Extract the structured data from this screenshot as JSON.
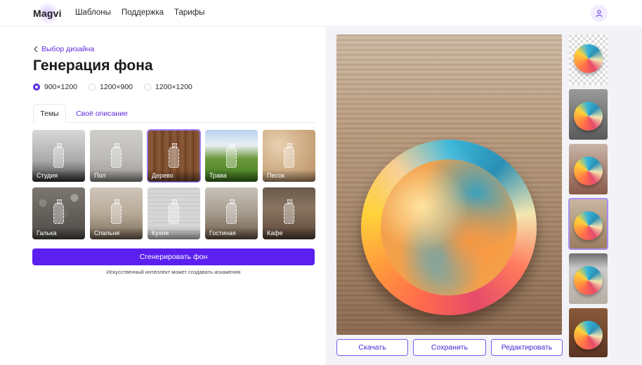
{
  "header": {
    "logo": "Magvi",
    "nav": [
      "Шаблоны",
      "Поддержка",
      "Тарифы"
    ],
    "profile_icon": "user-icon"
  },
  "left": {
    "back_link": "Выбор дизайна",
    "title": "Генерация фона",
    "sizes": [
      {
        "label": "900×1200",
        "selected": true
      },
      {
        "label": "1200×900",
        "selected": false
      },
      {
        "label": "1200×1200",
        "selected": false
      }
    ],
    "tabs": [
      {
        "label": "Темы",
        "active": true
      },
      {
        "label": "Своё описание",
        "active": false
      }
    ],
    "themes": [
      {
        "label": "Студия",
        "selected": false
      },
      {
        "label": "Пол",
        "selected": false
      },
      {
        "label": "Дерево",
        "selected": true
      },
      {
        "label": "Трава",
        "selected": false
      },
      {
        "label": "Песок",
        "selected": false
      },
      {
        "label": "Галька",
        "selected": false
      },
      {
        "label": "Спальня",
        "selected": false
      },
      {
        "label": "Кухня",
        "selected": false
      },
      {
        "label": "Гостиная",
        "selected": false
      },
      {
        "label": "Кафе",
        "selected": false
      }
    ],
    "generate_button": "Сгенерировать фон",
    "disclaimer": "Искусственный интеллект может создавать искажения"
  },
  "right": {
    "actions": [
      "Скачать",
      "Сохранить",
      "Редактировать"
    ],
    "thumbnails": [
      {
        "background": "transparent",
        "selected": false
      },
      {
        "background": "studio",
        "selected": false
      },
      {
        "background": "wall",
        "selected": false
      },
      {
        "background": "wood",
        "selected": true
      },
      {
        "background": "interior",
        "selected": false
      },
      {
        "background": "wood-dark",
        "selected": false
      }
    ]
  },
  "colors": {
    "accent": "#5b1ff0",
    "link": "#5b2de0"
  }
}
